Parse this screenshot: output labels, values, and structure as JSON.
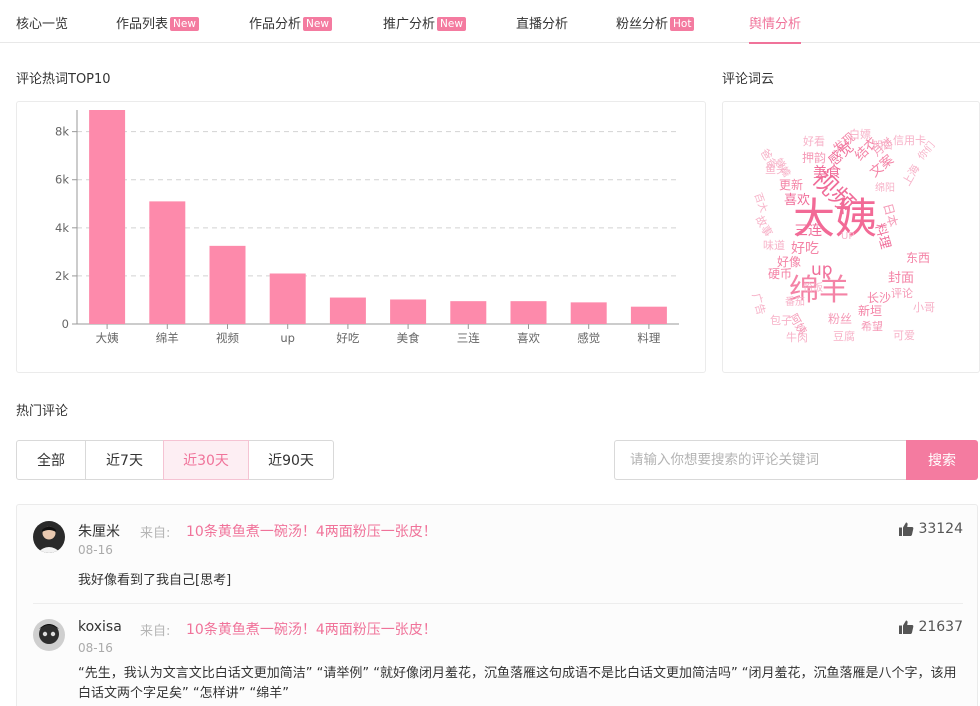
{
  "tabs": [
    {
      "label": "核心一览",
      "badge": ""
    },
    {
      "label": "作品列表",
      "badge": "New"
    },
    {
      "label": "作品分析",
      "badge": "New"
    },
    {
      "label": "推广分析",
      "badge": "New"
    },
    {
      "label": "直播分析",
      "badge": ""
    },
    {
      "label": "粉丝分析",
      "badge": "Hot"
    },
    {
      "label": "舆情分析",
      "badge": ""
    }
  ],
  "active_tab": "舆情分析",
  "chart_section_title": "评论热词TOP10",
  "cloud_section_title": "评论词云",
  "hot_comments_title": "热门评论",
  "colors": {
    "accent": "#f0739a",
    "bar": "#fd8aab"
  },
  "chart_data": {
    "type": "bar",
    "categories": [
      "大姨",
      "绵羊",
      "视频",
      "up",
      "好吃",
      "美食",
      "三连",
      "喜欢",
      "感觉",
      "料理"
    ],
    "values": [
      8900,
      5100,
      3250,
      2100,
      1100,
      1020,
      950,
      950,
      900,
      720
    ],
    "ylim": [
      0,
      8900
    ],
    "yticks": [
      0,
      2000,
      4000,
      6000,
      8000
    ],
    "ytick_labels": [
      "0",
      "2k",
      "4k",
      "6k",
      "8k"
    ],
    "grid": true,
    "title": "",
    "xlabel": "",
    "ylabel": ""
  },
  "word_cloud": [
    {
      "text": "大姨",
      "color": "#f26a96"
    },
    {
      "text": "绵羊",
      "color": "#f483a6"
    },
    {
      "text": "视频",
      "color": "#f06d99"
    },
    {
      "text": "up",
      "color": "#f06d99"
    },
    {
      "text": "好吃",
      "color": "#f483a6"
    },
    {
      "text": "美食",
      "color": "#f06d99"
    },
    {
      "text": "三连",
      "color": "#f06d99"
    },
    {
      "text": "喜欢",
      "color": "#f06d99"
    },
    {
      "text": "感觉",
      "color": "#f06d99"
    },
    {
      "text": "料理",
      "color": "#f06d99"
    },
    {
      "text": "封面",
      "color": "#f483a6"
    },
    {
      "text": "东西",
      "color": "#f483a6"
    },
    {
      "text": "新垣",
      "color": "#f483a6"
    },
    {
      "text": "长沙",
      "color": "#f483a6"
    },
    {
      "text": "评论",
      "color": "#f59ab7"
    },
    {
      "text": "粉丝",
      "color": "#f59ab7"
    },
    {
      "text": "硬币",
      "color": "#f483a6"
    },
    {
      "text": "好像",
      "color": "#f483a6"
    },
    {
      "text": "味道",
      "color": "#f7b2c8"
    },
    {
      "text": "更新",
      "color": "#f483a6"
    },
    {
      "text": "押韵",
      "color": "#f59ab7"
    },
    {
      "text": "发现",
      "color": "#f483a6"
    },
    {
      "text": "结衣",
      "color": "#f483a6"
    },
    {
      "text": "文案",
      "color": "#f483a6"
    },
    {
      "text": "月饼",
      "color": "#f59ab7"
    },
    {
      "text": "日本",
      "color": "#f59ab7"
    },
    {
      "text": "好看",
      "color": "#f7b2c8"
    },
    {
      "text": "白嫖",
      "color": "#f7b2c8"
    },
    {
      "text": "信用卡",
      "color": "#f7b2c8"
    },
    {
      "text": "包子",
      "color": "#f7b2c8"
    },
    {
      "text": "阿姨",
      "color": "#f59ab7"
    },
    {
      "text": "牛肉",
      "color": "#f7b2c8"
    },
    {
      "text": "豆腐",
      "color": "#f7b2c8"
    },
    {
      "text": "希望",
      "color": "#f59ab7"
    },
    {
      "text": "可爱",
      "color": "#f7b2c8"
    },
    {
      "text": "小哥",
      "color": "#f7b2c8"
    },
    {
      "text": "广告",
      "color": "#f7b2c8"
    },
    {
      "text": "上海",
      "color": "#f7b2c8"
    },
    {
      "text": "故事",
      "color": "#f7b2c8"
    },
    {
      "text": "鱼头",
      "color": "#f7b2c8"
    },
    {
      "text": "爸爸",
      "color": "#f7b2c8"
    },
    {
      "text": "蝉蟾",
      "color": "#f7b2c8"
    },
    {
      "text": "你们",
      "color": "#f7b2c8"
    },
    {
      "text": "百大",
      "color": "#f7b2c8"
    },
    {
      "text": "绵阳",
      "color": "#f7b2c8"
    },
    {
      "text": "恰饭",
      "color": "#f7b2c8"
    },
    {
      "text": "明白",
      "color": "#f7b2c8"
    },
    {
      "text": "番茄",
      "color": "#f7b2c8"
    },
    {
      "text": "UP",
      "color": "#f7b2c8"
    }
  ],
  "filters": [
    "全部",
    "近7天",
    "近30天",
    "近90天"
  ],
  "active_filter": "近30天",
  "search": {
    "placeholder": "请输入你想要搜索的评论关键词",
    "value": "",
    "button_label": "搜索"
  },
  "from_label": "来自:",
  "comments": [
    {
      "user": "朱厘米",
      "source": "10条黄鱼煮一碗汤！4两面粉压一张皮！",
      "date": "08-16",
      "likes": "33124",
      "text": "我好像看到了我自己[思考]"
    },
    {
      "user": "koxisa",
      "source": "10条黄鱼煮一碗汤！4两面粉压一张皮！",
      "date": "08-16",
      "likes": "21637",
      "text": "“先生，我认为文言文比白话文更加简洁” “请举例” “就好像闭月羞花，沉鱼落雁这句成语不是比白话文更加简洁吗” “闭月羞花，沉鱼落雁是八个字，该用白话文两个字足矣” “怎样讲” “绵羊”"
    }
  ]
}
